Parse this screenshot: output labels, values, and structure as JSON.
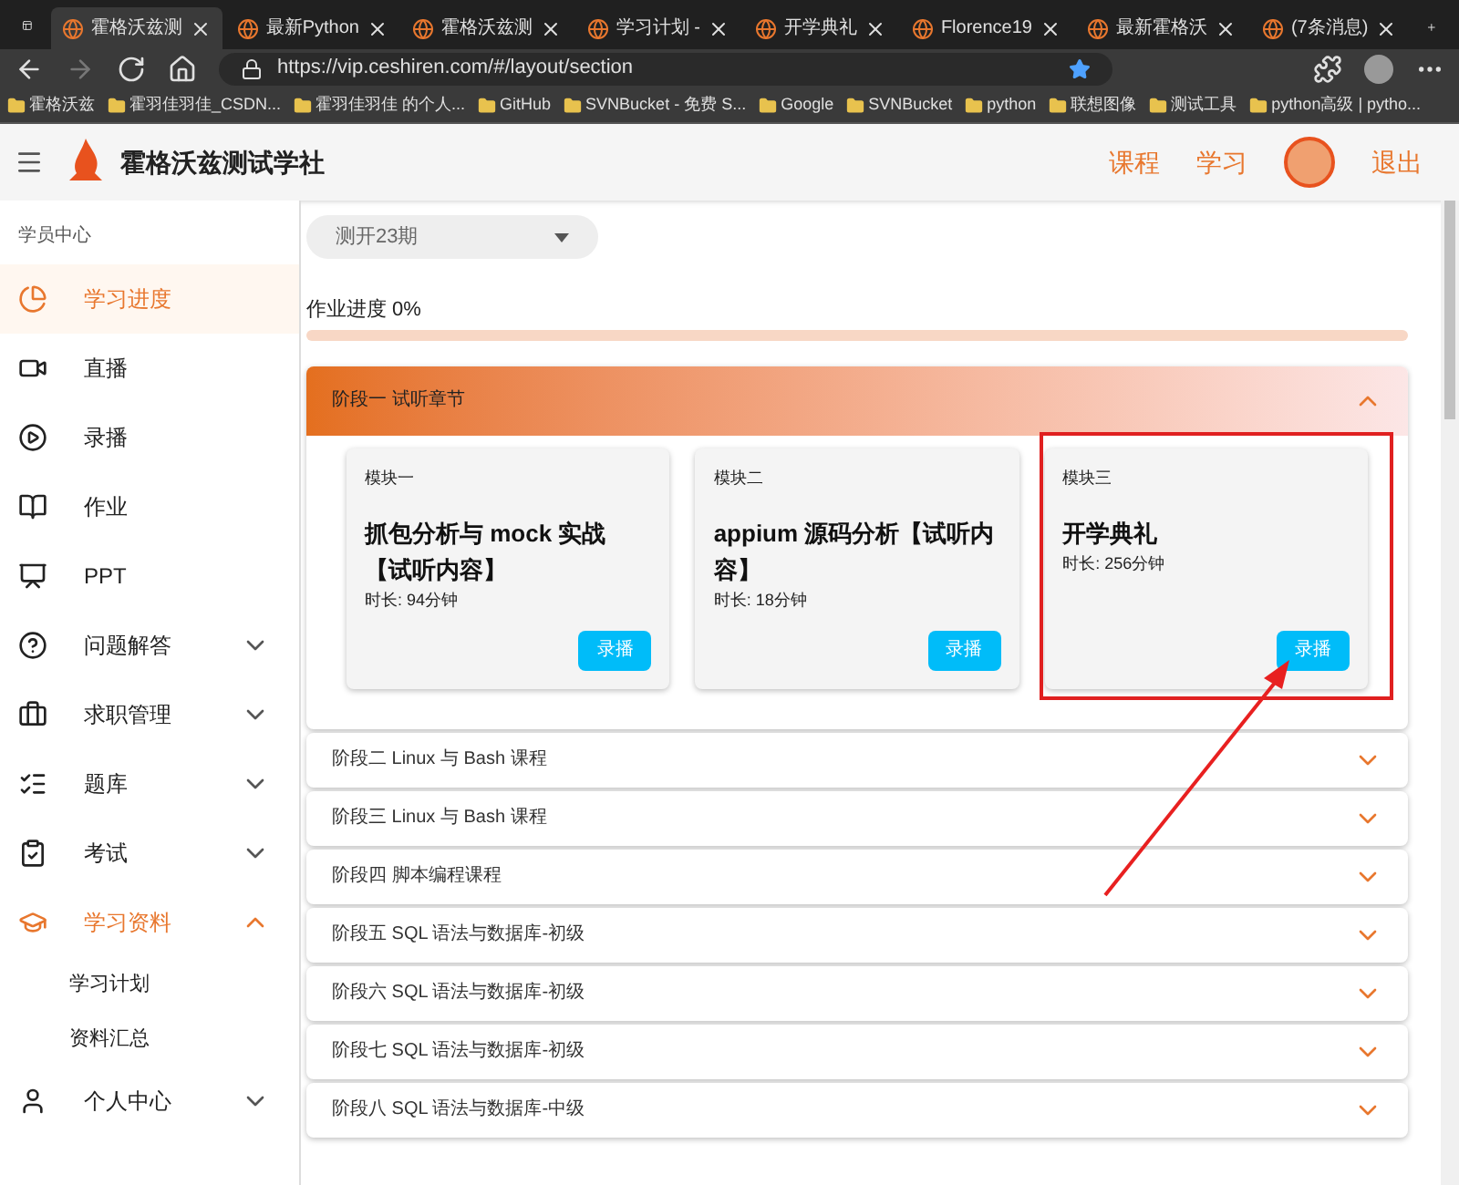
{
  "browser": {
    "tabs": [
      {
        "title": "霍格沃兹测",
        "selected": true
      },
      {
        "title": "最新Python",
        "selected": false
      },
      {
        "title": "霍格沃兹测",
        "selected": false
      },
      {
        "title": "学习计划 -",
        "selected": false
      },
      {
        "title": "开学典礼",
        "selected": false
      },
      {
        "title": "Florence19",
        "selected": false
      },
      {
        "title": "最新霍格沃",
        "selected": false
      },
      {
        "title": "(7条消息)",
        "selected": false
      }
    ],
    "url": "https://vip.ceshiren.com/#/layout/section",
    "bookmarks": [
      "霍格沃兹",
      "霍羽佳羽佳_CSDN...",
      "霍羽佳羽佳 的个人...",
      "GitHub",
      "SVNBucket - 免费 S...",
      "Google",
      "SVNBucket",
      "python",
      "联想图像",
      "测试工具",
      "python高级 | pytho..."
    ]
  },
  "header": {
    "brand": "霍格沃兹测试学社",
    "nav": [
      "课程",
      "学习"
    ],
    "logout": "退出"
  },
  "sidebar": {
    "section": "学员中心",
    "items": [
      {
        "label": "学习进度",
        "selected": true
      },
      {
        "label": "直播",
        "selected": false
      },
      {
        "label": "录播",
        "selected": false
      },
      {
        "label": "作业",
        "selected": false
      },
      {
        "label": "PPT",
        "selected": false
      },
      {
        "label": "问题解答",
        "selected": false,
        "expanded": false
      },
      {
        "label": "求职管理",
        "selected": false,
        "expanded": false
      },
      {
        "label": "题库",
        "selected": false,
        "expanded": false
      },
      {
        "label": "考试",
        "selected": false,
        "expanded": false
      },
      {
        "label": "学习资料",
        "selected": false,
        "expanded": true,
        "children": [
          "学习计划",
          "资料汇总"
        ]
      },
      {
        "label": "个人中心",
        "selected": false,
        "expanded": false
      }
    ]
  },
  "class_select": {
    "value": "测开23期"
  },
  "progress": {
    "label": "作业进度 0%",
    "level": 0
  },
  "stages": [
    {
      "title": "阶段一 试听章节",
      "expanded": true,
      "modules": [
        {
          "tag": "模块一",
          "title": "抓包分析与 mock 实战【试听内容】",
          "duration": "时长: 94分钟",
          "button": "录播"
        },
        {
          "tag": "模块二",
          "title": "appium 源码分析【试听内容】",
          "duration": "时长: 18分钟",
          "button": "录播"
        },
        {
          "tag": "模块三",
          "title": "开学典礼",
          "duration": "时长: 256分钟",
          "button": "录播"
        }
      ]
    },
    {
      "title": "阶段二 Linux 与 Bash 课程",
      "expanded": false
    },
    {
      "title": "阶段三 Linux 与 Bash 课程",
      "expanded": false
    },
    {
      "title": "阶段四 脚本编程课程",
      "expanded": false
    },
    {
      "title": "阶段五 SQL 语法与数据库-初级",
      "expanded": false
    },
    {
      "title": "阶段六 SQL 语法与数据库-初级",
      "expanded": false
    },
    {
      "title": "阶段七 SQL 语法与数据库-初级",
      "expanded": false
    },
    {
      "title": "阶段八 SQL 语法与数据库-中级",
      "expanded": false
    }
  ]
}
